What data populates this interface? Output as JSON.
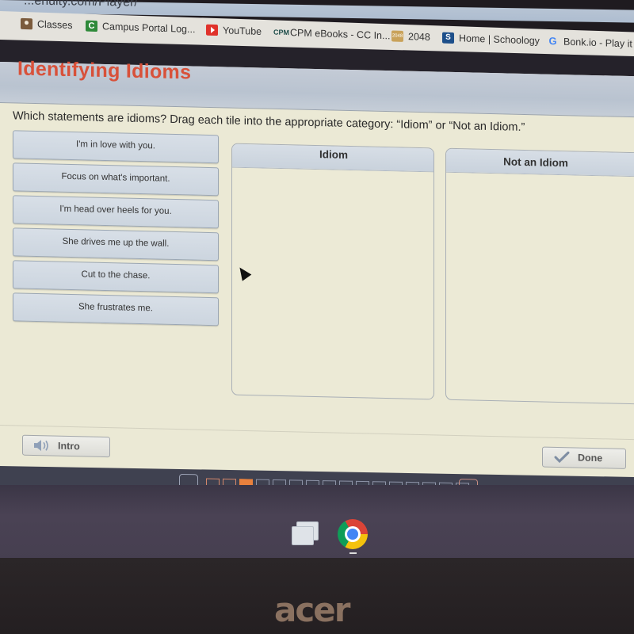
{
  "browser": {
    "url": "...enuity.com/Player/",
    "bookmarks": [
      {
        "label": "Classes",
        "icon": "google-classroom-icon"
      },
      {
        "label": "Campus Portal Log...",
        "icon": "campus-portal-icon"
      },
      {
        "label": "YouTube",
        "icon": "youtube-icon"
      },
      {
        "label": "CPM eBooks - CC In...",
        "icon": "cpm-icon"
      },
      {
        "label": "2048",
        "icon": "2048-icon"
      },
      {
        "label": "Home | Schoology",
        "icon": "schoology-icon"
      },
      {
        "label": "Bonk.io - Play it on",
        "icon": "google-icon"
      }
    ]
  },
  "lesson": {
    "title": "Identifying Idioms",
    "instructions": "Which statements are idioms? Drag each tile into the appropriate category: “Idiom” or “Not an Idiom.”",
    "tiles": [
      "I'm in love with you.",
      "Focus on what's important.",
      "I'm head over heels for you.",
      "She drives me up the wall.",
      "Cut to the chase.",
      "She frustrates me."
    ],
    "categories": [
      {
        "label": "Idiom",
        "items": []
      },
      {
        "label": "Not an Idiom",
        "items": []
      }
    ],
    "intro_button": "Intro",
    "done_button": "Done"
  },
  "navigation": {
    "total_pages": 16,
    "completed_pages": 2,
    "current_page": 3
  },
  "shelf": {
    "apps": [
      "files-app",
      "chrome"
    ]
  },
  "hardware": {
    "brand": "acer"
  }
}
